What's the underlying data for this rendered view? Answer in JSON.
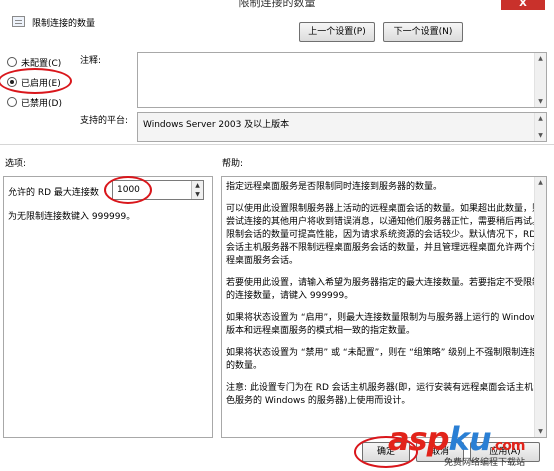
{
  "window": {
    "title": "限制连接的数量",
    "close_glyph": "X"
  },
  "header": {
    "policy_title": "限制连接的数量",
    "prev_button": "上一个设置(P)",
    "next_button": "下一个设置(N)"
  },
  "options": {
    "not_configured": "未配置(C)",
    "enabled": "已启用(E)",
    "disabled": "已禁用(D)",
    "selected": "enabled"
  },
  "comment": {
    "label": "注释:",
    "value": ""
  },
  "supported": {
    "label": "支持的平台:",
    "value": "Windows Server 2003 及以上版本"
  },
  "sections": {
    "options_label": "选项:",
    "help_label": "帮助:"
  },
  "setting": {
    "label": "允许的 RD 最大连接数",
    "value": "1000",
    "note": "为无限制连接数键入 999999。"
  },
  "help": {
    "paragraphs": [
      "指定远程桌面服务是否限制同时连接到服务器的数量。",
      "可以使用此设置限制服务器上活动的远程桌面会话的数量。如果超出此数量，则尝试连接的其他用户将收到错误消息，以通知他们服务器正忙，需要稍后再试。限制会话的数量可提高性能，因为请求系统资源的会话较少。默认情况下，RD 会话主机服务器不限制远程桌面服务会话的数量，并且管理远程桌面允许两个远程桌面服务会话。",
      "若要使用此设置，请输入希望为服务器指定的最大连接数量。若要指定不受限制的连接数量，请键入 999999。",
      "如果将状态设置为 “启用”，则最大连接数量限制为与服务器上运行的 Windows 版本和远程桌面服务的模式相一致的指定数量。",
      "如果将状态设置为 “禁用” 或 “未配置”，则在 “组策略” 级别上不强制限制连接的数量。",
      "注意: 此设置专门为在 RD 会话主机服务器(即，运行安装有远程桌面会话主机角色服务的 Windows 的服务器)上使用而设计。"
    ]
  },
  "footer": {
    "ok_button": "确定",
    "cancel_button": "取消",
    "apply_button": "应用(A)"
  },
  "watermark": {
    "logo_a": "asp",
    "logo_b": "ku",
    "tld": ".com",
    "subtitle": "免费网络编程下载站"
  },
  "colors": {
    "annotation_red": "#d9161b"
  }
}
